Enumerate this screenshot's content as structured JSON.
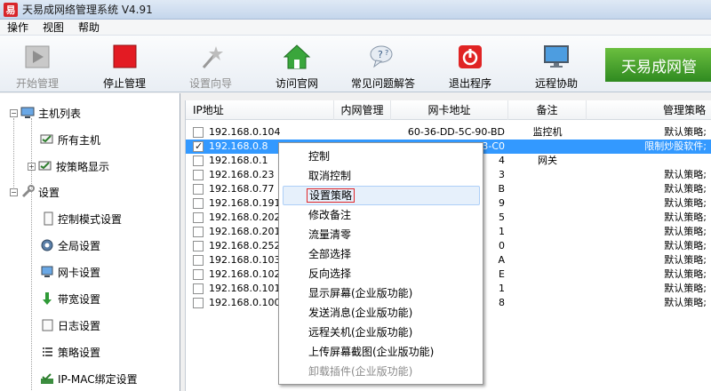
{
  "window": {
    "title": "天易成网络管理系统 V4.91",
    "icon_glyph": "易"
  },
  "menubar": [
    "操作",
    "视图",
    "帮助"
  ],
  "toolbar": [
    {
      "label": "开始管理",
      "icon": "start-manage-icon",
      "enabled": false
    },
    {
      "label": "停止管理",
      "icon": "stop-manage-icon",
      "enabled": true
    },
    {
      "label": "设置向导",
      "icon": "wizard-icon",
      "enabled": false
    },
    {
      "label": "访问官网",
      "icon": "home-icon",
      "enabled": true
    },
    {
      "label": "常见问题解答",
      "icon": "faq-icon",
      "enabled": true
    },
    {
      "label": "退出程序",
      "icon": "power-icon",
      "enabled": true
    },
    {
      "label": "远程协助",
      "icon": "monitor-icon",
      "enabled": true
    }
  ],
  "brand": "天易成网管",
  "tree": [
    {
      "label": "主机列表",
      "expander": "−",
      "icon": "computer-icon"
    },
    {
      "label": "所有主机",
      "icon": "hosts-icon"
    },
    {
      "label": "按策略显示",
      "expander": "+",
      "icon": "policy-group-icon"
    },
    {
      "label": "设置",
      "expander": "−",
      "icon": "wrench-icon"
    },
    {
      "label": "控制模式设置",
      "icon": "doc-icon"
    },
    {
      "label": "全局设置",
      "icon": "gear-icon"
    },
    {
      "label": "网卡设置",
      "icon": "nic-icon"
    },
    {
      "label": "带宽设置",
      "icon": "down-arrow-icon"
    },
    {
      "label": "日志设置",
      "icon": "log-icon"
    },
    {
      "label": "策略设置",
      "icon": "policy-icon"
    },
    {
      "label": "IP-MAC绑定设置",
      "icon": "bind-icon"
    }
  ],
  "list": {
    "columns": [
      "IP地址",
      "内网管理",
      "网卡地址",
      "备注",
      "管理策略"
    ],
    "rows": [
      {
        "checked": false,
        "ip": "192.168.0.104",
        "mac": "60-36-DD-5C-90-BD",
        "note": "监控机",
        "policy": "默认策略;",
        "selected": false
      },
      {
        "checked": true,
        "ip": "192.168.0.8",
        "mac": "88-87-17-10-13-C0",
        "note": "",
        "policy": "限制炒股软件;",
        "selected": true
      },
      {
        "checked": false,
        "ip": "192.168.0.1",
        "mac": "4",
        "note": "网关",
        "policy": "",
        "selected": false
      },
      {
        "checked": false,
        "ip": "192.168.0.23",
        "mac": "3",
        "note": "",
        "policy": "默认策略;",
        "selected": false
      },
      {
        "checked": false,
        "ip": "192.168.0.77",
        "mac": "B",
        "note": "",
        "policy": "默认策略;",
        "selected": false
      },
      {
        "checked": false,
        "ip": "192.168.0.191",
        "mac": "9",
        "note": "",
        "policy": "默认策略;",
        "selected": false
      },
      {
        "checked": false,
        "ip": "192.168.0.202",
        "mac": "5",
        "note": "",
        "policy": "默认策略;",
        "selected": false
      },
      {
        "checked": false,
        "ip": "192.168.0.201",
        "mac": "1",
        "note": "",
        "policy": "默认策略;",
        "selected": false
      },
      {
        "checked": false,
        "ip": "192.168.0.252",
        "mac": "0",
        "note": "",
        "policy": "默认策略;",
        "selected": false
      },
      {
        "checked": false,
        "ip": "192.168.0.103",
        "mac": "A",
        "note": "",
        "policy": "默认策略;",
        "selected": false
      },
      {
        "checked": false,
        "ip": "192.168.0.102",
        "mac": "E",
        "note": "",
        "policy": "默认策略;",
        "selected": false
      },
      {
        "checked": false,
        "ip": "192.168.0.101",
        "mac": "1",
        "note": "",
        "policy": "默认策略;",
        "selected": false
      },
      {
        "checked": false,
        "ip": "192.168.0.100",
        "mac": "8",
        "note": "",
        "policy": "默认策略;",
        "selected": false
      }
    ]
  },
  "context_menu": [
    {
      "label": "控制",
      "enabled": true
    },
    {
      "label": "取消控制",
      "enabled": true
    },
    {
      "label": "设置策略",
      "enabled": true,
      "highlight": true
    },
    {
      "label": "修改备注",
      "enabled": true
    },
    {
      "label": "流量清零",
      "enabled": true
    },
    {
      "label": "全部选择",
      "enabled": true
    },
    {
      "label": "反向选择",
      "enabled": true
    },
    {
      "label": "显示屏幕(企业版功能)",
      "enabled": true
    },
    {
      "label": "发送消息(企业版功能)",
      "enabled": true
    },
    {
      "label": "远程关机(企业版功能)",
      "enabled": true
    },
    {
      "label": "上传屏幕截图(企业版功能)",
      "enabled": true
    },
    {
      "label": "卸载插件(企业版功能)",
      "enabled": false
    }
  ],
  "colors": {
    "selection": "#3399ff",
    "highlight_border": "#e0262a",
    "brand_green": "#3a9a2a"
  }
}
